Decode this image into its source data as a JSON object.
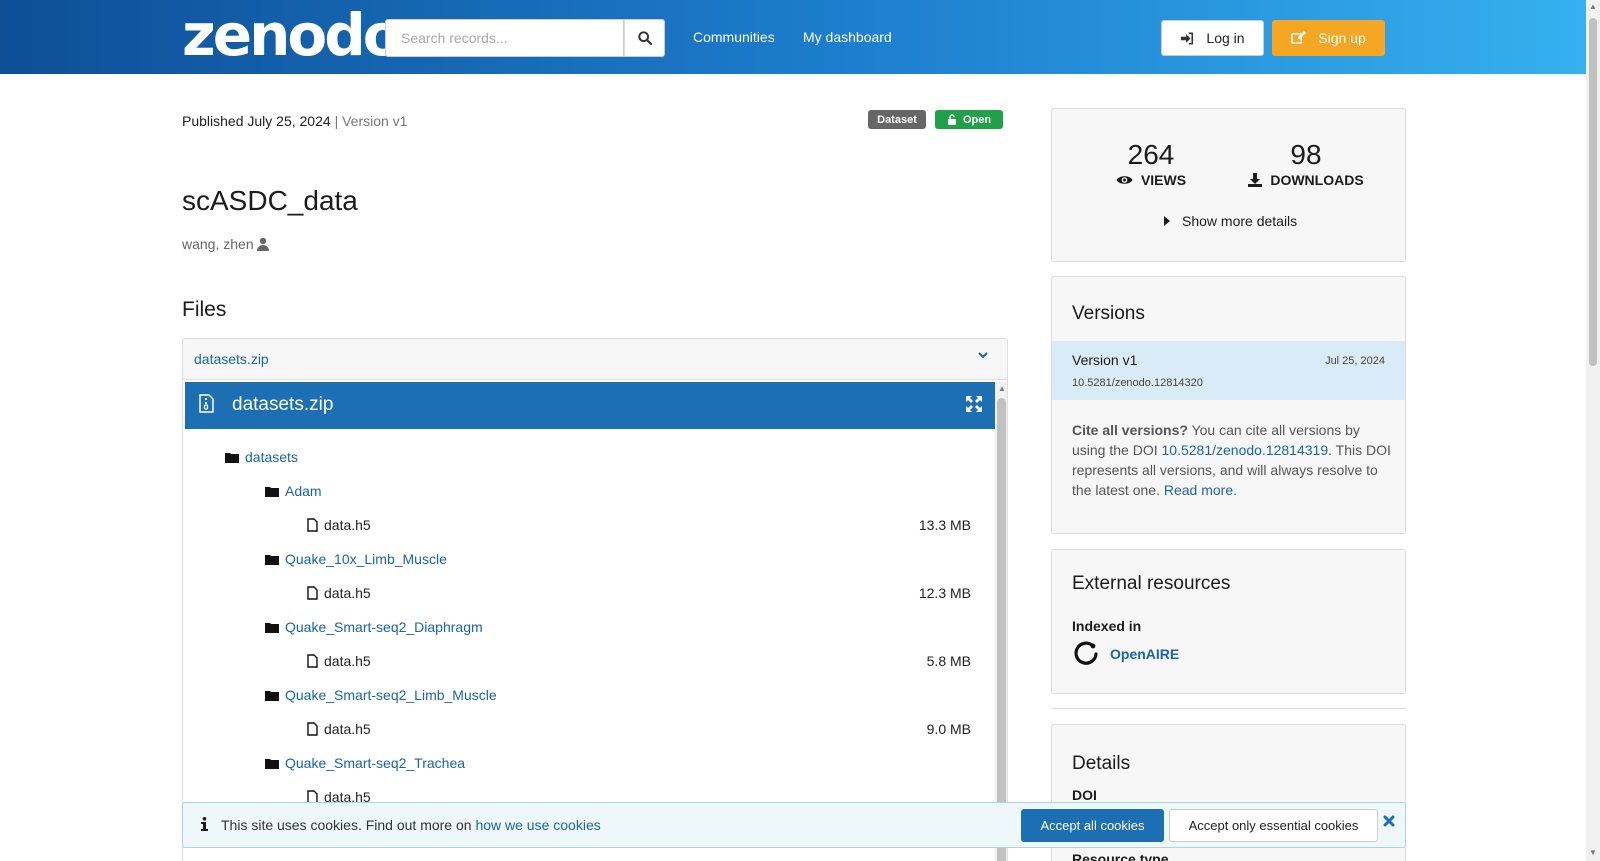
{
  "header": {
    "logo": "zenodo",
    "search_placeholder": "Search records...",
    "nav": [
      "Communities",
      "My dashboard"
    ],
    "login": "Log in",
    "signup": "Sign up"
  },
  "record": {
    "published": "Published July 25, 2024",
    "version": "| Version v1",
    "badge_type": "Dataset",
    "badge_access": "Open",
    "title": "scASDC_data",
    "creator": "wang, zhen"
  },
  "files": {
    "heading": "Files",
    "archive": "datasets.zip",
    "preview_title": "datasets.zip",
    "tree": {
      "root": "datasets",
      "folders": [
        {
          "name": "Adam",
          "file": "data.h5",
          "size": "13.3 MB"
        },
        {
          "name": "Quake_10x_Limb_Muscle",
          "file": "data.h5",
          "size": "12.3 MB"
        },
        {
          "name": "Quake_Smart-seq2_Diaphragm",
          "file": "data.h5",
          "size": "5.8 MB"
        },
        {
          "name": "Quake_Smart-seq2_Limb_Muscle",
          "file": "data.h5",
          "size": "9.0 MB"
        },
        {
          "name": "Quake_Smart-seq2_Trachea",
          "file": "data.h5",
          "size": ""
        }
      ]
    }
  },
  "stats": {
    "views": "264",
    "views_label": "VIEWS",
    "downloads": "98",
    "downloads_label": "DOWNLOADS",
    "show_more": "Show more details"
  },
  "versions": {
    "heading": "Versions",
    "current": {
      "name": "Version v1",
      "date": "Jul 25, 2024",
      "doi": "10.5281/zenodo.12814320"
    },
    "cite_bold": "Cite all versions?",
    "cite_text1": " You can cite all versions by using the DOI ",
    "cite_doi": "10.5281/zenodo.12814319",
    "cite_text2": ". This DOI represents all versions, and will always resolve to the latest one. ",
    "read_more": "Read more."
  },
  "external": {
    "heading": "External resources",
    "indexed_in": "Indexed in",
    "openaire": "OpenAIRE"
  },
  "details": {
    "heading": "Details",
    "doi_label": "DOI",
    "resource_type_label": "Resource type"
  },
  "cookie": {
    "message": "This site uses cookies. Find out more on ",
    "link": "how we use cookies",
    "accept_all": "Accept all cookies",
    "accept_essential": "Accept only essential cookies"
  },
  "colors": {
    "header_start": "#0e4f96",
    "header_end": "#36b0ee",
    "link": "#1a64a8",
    "signup": "#f5a623",
    "open_badge": "#21a04a",
    "preview_bar": "#1d6fb4"
  }
}
